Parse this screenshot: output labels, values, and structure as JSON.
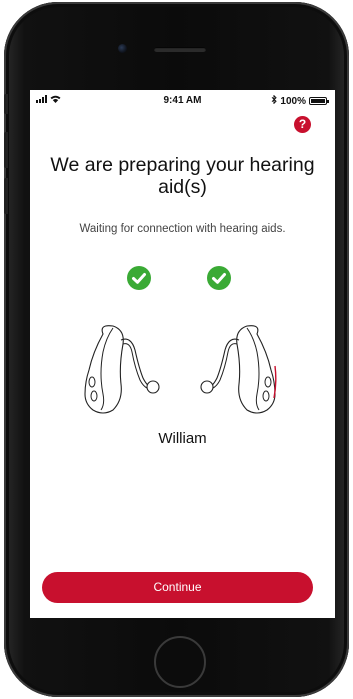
{
  "status_bar": {
    "time": "9:41 AM",
    "battery": "100%"
  },
  "header": {
    "help_icon": "question-mark-icon",
    "help_label": "?"
  },
  "main": {
    "title": "We are preparing your hearing aid(s)",
    "subtitle": "Waiting for connection with hearing aids.",
    "left_status_icon": "check-icon",
    "right_status_icon": "check-icon",
    "device_name": "William"
  },
  "footer": {
    "continue_label": "Continue"
  },
  "colors": {
    "accent": "#c8102e",
    "success": "#3aaa35",
    "text": "#111111"
  }
}
